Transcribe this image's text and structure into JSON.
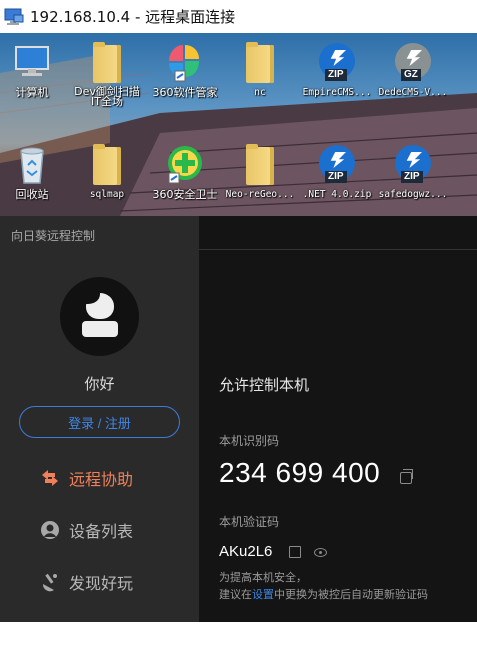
{
  "window": {
    "title": "192.168.10.4 - 远程桌面连接"
  },
  "desktop": {
    "icons": [
      {
        "name": "computer",
        "label": "计算机",
        "kind": "computer"
      },
      {
        "name": "folder-dev",
        "label": "Dev御剑扫描\nIT全场",
        "kind": "folder"
      },
      {
        "name": "360-software",
        "label": "360软件管家",
        "kind": "app360"
      },
      {
        "name": "folder-nc",
        "label": "nc",
        "kind": "folder"
      },
      {
        "name": "empirecms",
        "label": "EmpireCMS...",
        "kind": "zip",
        "tag": "ZIP"
      },
      {
        "name": "dedecms",
        "label": "DedeCMS-V...",
        "kind": "gz",
        "tag": "GZ"
      },
      {
        "name": "recycle-bin",
        "label": "回收站",
        "kind": "recycle"
      },
      {
        "name": "folder-sqlmap",
        "label": "sqlmap",
        "kind": "folder"
      },
      {
        "name": "360-safe",
        "label": "360安全卫士",
        "kind": "safe360"
      },
      {
        "name": "folder-neo",
        "label": "Neo-reGeo...",
        "kind": "folder"
      },
      {
        "name": "net40",
        "label": ".NET 4.0.zip",
        "kind": "zip",
        "tag": "ZIP"
      },
      {
        "name": "safedog",
        "label": "safedogwz...",
        "kind": "zip",
        "tag": "ZIP"
      }
    ]
  },
  "sidebar": {
    "heading": "向日葵远程控制",
    "greeting": "你好",
    "login_label": "登录 / 注册",
    "nav": [
      {
        "label": "远程协助",
        "icon": "remote-assist-icon",
        "active": true
      },
      {
        "label": "设备列表",
        "icon": "device-list-icon",
        "active": false
      },
      {
        "label": "发现好玩",
        "icon": "discover-icon",
        "active": false
      }
    ]
  },
  "main": {
    "title": "允许控制本机",
    "id_label": "本机识别码",
    "id_value": "234 699 400",
    "code_label": "本机验证码",
    "code_value": "AKu2L6",
    "tip_line1": "为提高本机安全，",
    "tip_line2_pre": "建议在",
    "tip_link": "设置",
    "tip_line2_post": "中更换为被控后自动更新验证码"
  },
  "colors": {
    "accent": "#3d86e8",
    "active_nav": "#f0805a",
    "sidebar_bg": "#2a2a2a",
    "content_bg": "#141414"
  }
}
